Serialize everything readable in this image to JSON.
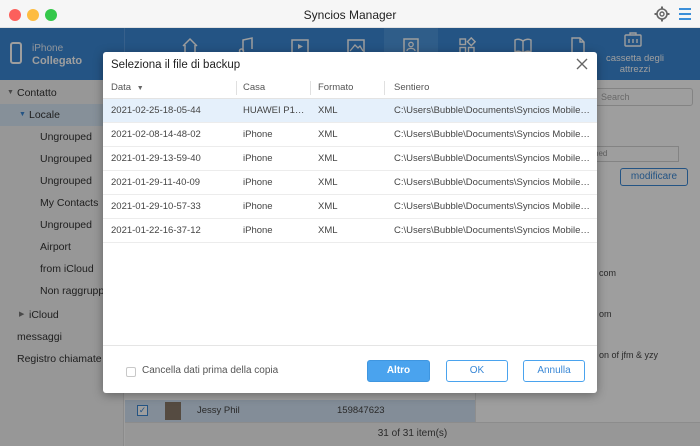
{
  "app": {
    "title": "Syncios Manager"
  },
  "device": {
    "label": "iPhone",
    "status": "Collegato"
  },
  "header": {
    "tools_label": "cassetta degli attrezzi"
  },
  "sidebar": {
    "contatto": "Contatto",
    "locale": "Locale",
    "groups": [
      "Ungrouped",
      "Ungrouped",
      "Ungrouped",
      "My Contacts",
      "Ungrouped",
      "Airport",
      "from iCloud",
      "Non raggruppa"
    ],
    "icloud": "iCloud",
    "messaggi": "messaggi",
    "registro": "Registro chiamate"
  },
  "main": {
    "search_placeholder": "Search",
    "input_fragment": "ned",
    "modify_button": "modificare",
    "right_fragments": [
      "com",
      "om",
      "on of jfm & yzy"
    ],
    "contact_row": {
      "checked": "✓",
      "name": "Jessy Phil",
      "phone": "159847623"
    },
    "footer_count": "31 of 31 item(s)"
  },
  "dialog": {
    "title": "Seleziona il file di backup",
    "columns": {
      "data": "Data",
      "sort": "▼",
      "casa": "Casa",
      "formato": "Formato",
      "sentiero": "Sentiero"
    },
    "rows": [
      {
        "data": "2021-02-25-18-05-44",
        "casa": "HUAWEI P10 ...",
        "formato": "XML",
        "sentiero": "C:\\Users\\Bubble\\Documents\\Syncios Mobile M..."
      },
      {
        "data": "2021-02-08-14-48-02",
        "casa": "iPhone",
        "formato": "XML",
        "sentiero": "C:\\Users\\Bubble\\Documents\\Syncios Mobile M..."
      },
      {
        "data": "2021-01-29-13-59-40",
        "casa": "iPhone",
        "formato": "XML",
        "sentiero": "C:\\Users\\Bubble\\Documents\\Syncios Mobile M..."
      },
      {
        "data": "2021-01-29-11-40-09",
        "casa": "iPhone",
        "formato": "XML",
        "sentiero": "C:\\Users\\Bubble\\Documents\\Syncios Mobile M..."
      },
      {
        "data": "2021-01-29-10-57-33",
        "casa": "iPhone",
        "formato": "XML",
        "sentiero": "C:\\Users\\Bubble\\Documents\\Syncios Mobile M..."
      },
      {
        "data": "2021-01-22-16-37-12",
        "casa": "iPhone",
        "formato": "XML",
        "sentiero": "C:\\Users\\Bubble\\Documents\\Syncios Mobile M..."
      }
    ],
    "checkbox_label": "Cancella dati prima della copia",
    "buttons": {
      "altro": "Altro",
      "ok": "OK",
      "annulla": "Annulla"
    }
  }
}
